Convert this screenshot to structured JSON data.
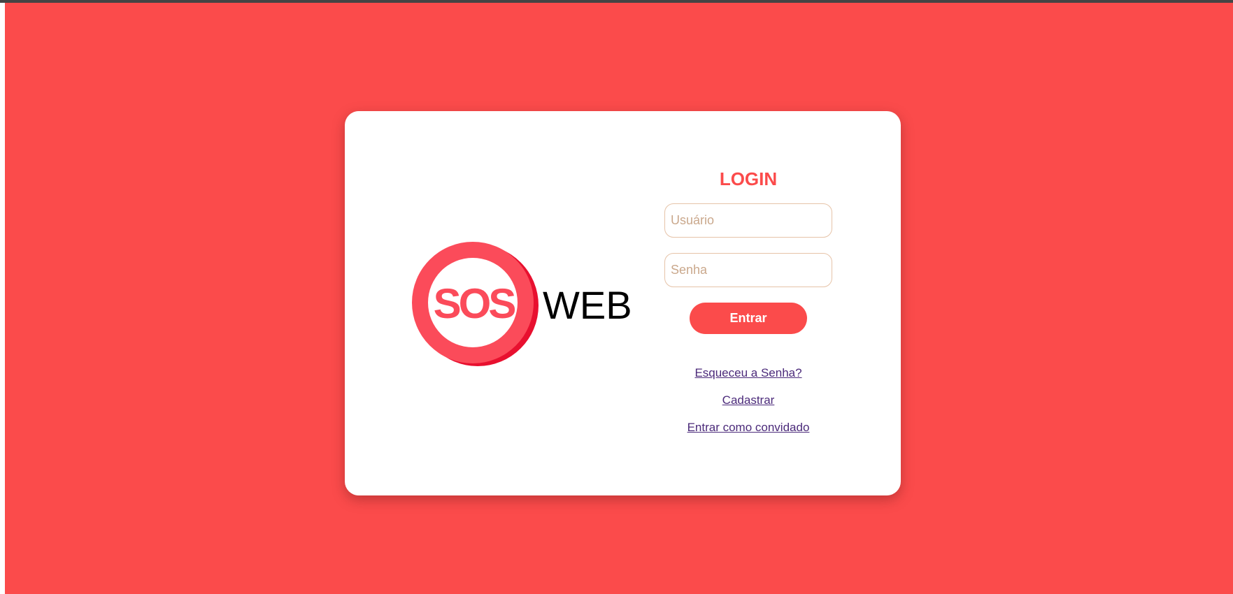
{
  "colors": {
    "background": "#fb4b4b",
    "accent": "#fb4b4b",
    "logo_outer": "#fb4b5a",
    "logo_shadow": "#e8102f",
    "logo_text": "#fb4b5a",
    "link": "#4b2a7a"
  },
  "logo": {
    "icon_text": "SOS",
    "word": "WEB"
  },
  "login": {
    "title": "LOGIN",
    "username": {
      "placeholder": "Usuário",
      "value": ""
    },
    "password": {
      "placeholder": "Senha",
      "value": ""
    },
    "submit_label": "Entrar"
  },
  "links": {
    "forgot_password": "Esqueceu a Senha?",
    "register": "Cadastrar",
    "guest": "Entrar como convidado"
  }
}
